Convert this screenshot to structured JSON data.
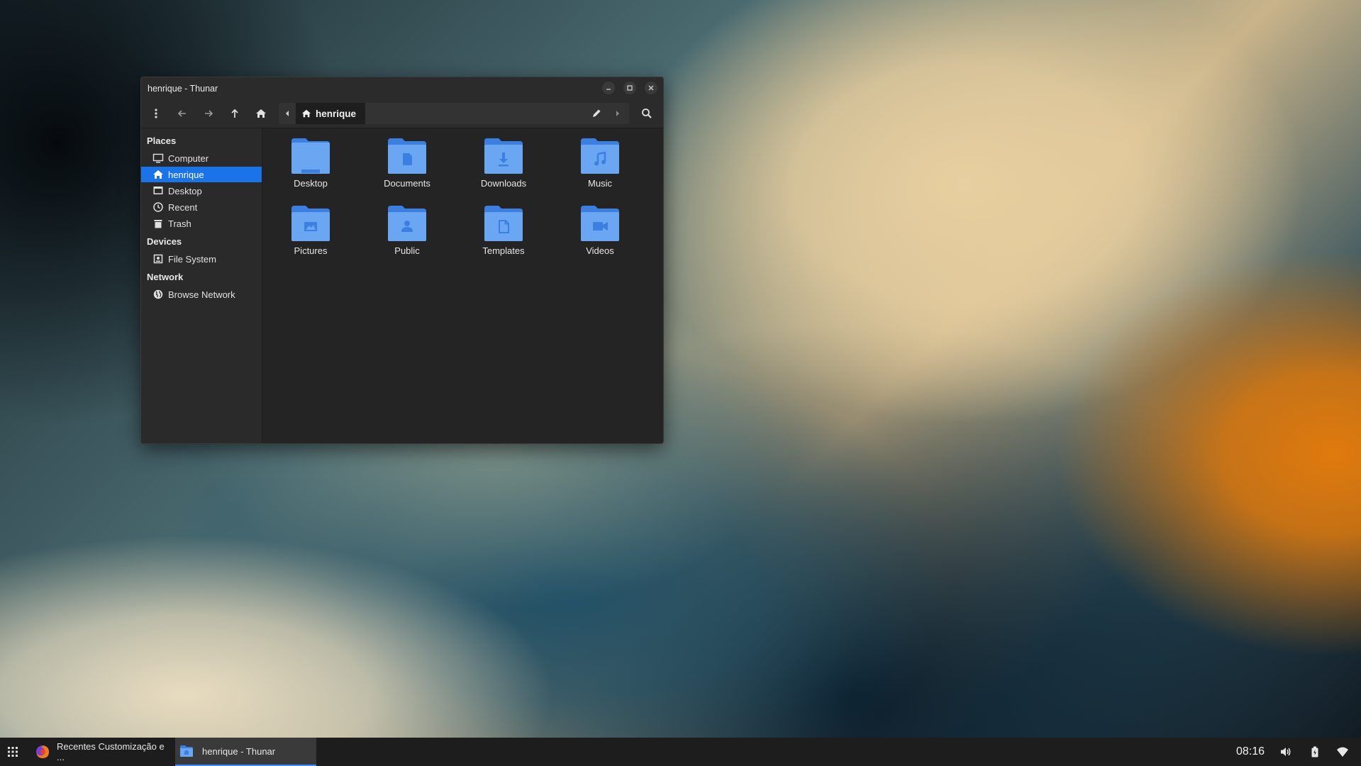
{
  "window": {
    "title": "henrique - Thunar",
    "path_crumb": "henrique"
  },
  "sidebar": {
    "sections": {
      "places": "Places",
      "devices": "Devices",
      "network": "Network"
    },
    "places": [
      {
        "label": "Computer",
        "icon": "computer-icon"
      },
      {
        "label": "henrique",
        "icon": "home-icon",
        "active": true
      },
      {
        "label": "Desktop",
        "icon": "desktop-icon"
      },
      {
        "label": "Recent",
        "icon": "clock-icon"
      },
      {
        "label": "Trash",
        "icon": "trash-icon"
      }
    ],
    "devices": [
      {
        "label": "File System",
        "icon": "drive-icon"
      }
    ],
    "network": [
      {
        "label": "Browse Network",
        "icon": "globe-icon"
      }
    ]
  },
  "folders": [
    {
      "label": "Desktop",
      "icon": "folder-desktop-icon"
    },
    {
      "label": "Documents",
      "icon": "folder-documents-icon"
    },
    {
      "label": "Downloads",
      "icon": "folder-downloads-icon"
    },
    {
      "label": "Music",
      "icon": "folder-music-icon"
    },
    {
      "label": "Pictures",
      "icon": "folder-pictures-icon"
    },
    {
      "label": "Public",
      "icon": "folder-public-icon"
    },
    {
      "label": "Templates",
      "icon": "folder-templates-icon"
    },
    {
      "label": "Videos",
      "icon": "folder-videos-icon"
    }
  ],
  "taskbar": {
    "tasks": [
      {
        "label": "Recentes Customização e ...",
        "icon": "firefox-icon"
      },
      {
        "label": "henrique - Thunar",
        "icon": "thunar-icon",
        "active": true
      }
    ],
    "clock": "08:16"
  },
  "colors": {
    "accent": "#1a73e8",
    "folder": "#5b9bf0",
    "folder_dark": "#3d7fe0",
    "window_bg": "#242424",
    "taskbar_bg": "#1d1d1d"
  }
}
